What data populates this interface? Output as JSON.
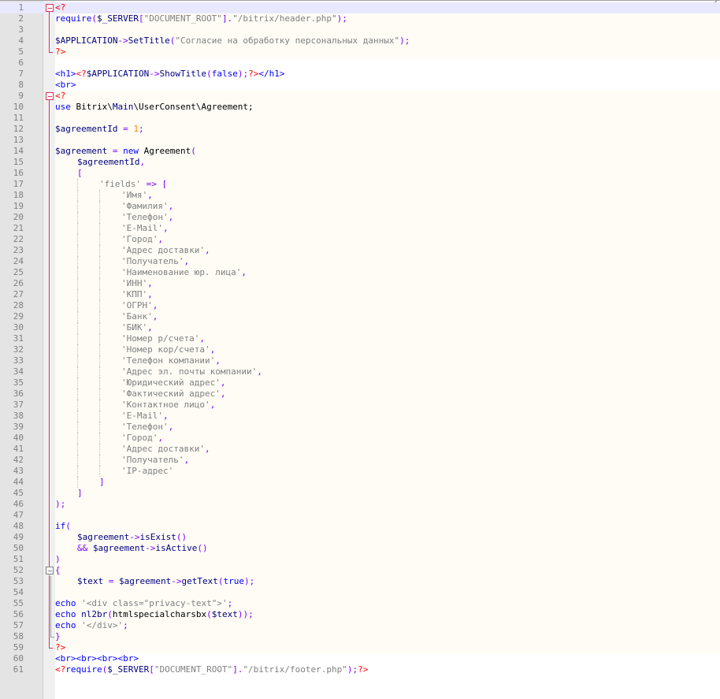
{
  "colors": {
    "php_tag": "#ff0000",
    "keyword": "#0000ff",
    "function": "#000080",
    "variable": "#000080",
    "operator": "#8000ff",
    "string": "#808080",
    "number": "#ff8000",
    "html_tag": "#0000ff",
    "current_line": "#e8e8ff",
    "gutter": "#e4e4e4"
  },
  "editor": {
    "current_line": 1,
    "lines": [
      {
        "n": "1",
        "indent": 0,
        "fold": "open",
        "php": true,
        "tokens": [
          [
            "tag",
            "<?"
          ]
        ]
      },
      {
        "n": "2",
        "indent": 0,
        "fold": "line",
        "php": true,
        "tokens": [
          [
            "kw",
            "require"
          ],
          [
            "op",
            "("
          ],
          [
            "var",
            "$_SERVER"
          ],
          [
            "op",
            "["
          ],
          [
            "str",
            "\"DOCUMENT_ROOT\""
          ],
          [
            "op",
            "]."
          ],
          [
            "str",
            "\"/bitrix/header.php\""
          ],
          [
            "op",
            ");"
          ]
        ]
      },
      {
        "n": "3",
        "indent": 0,
        "fold": "line",
        "php": true,
        "tokens": []
      },
      {
        "n": "4",
        "indent": 0,
        "fold": "line",
        "php": true,
        "tokens": [
          [
            "var",
            "$APPLICATION"
          ],
          [
            "op",
            "->"
          ],
          [
            "fn",
            "SetTitle"
          ],
          [
            "op",
            "("
          ],
          [
            "str",
            "\"Согласие на обработку персональных данных\""
          ],
          [
            "op",
            ");"
          ]
        ]
      },
      {
        "n": "5",
        "indent": 0,
        "fold": "end",
        "php": true,
        "tokens": [
          [
            "tag",
            "?>"
          ]
        ]
      },
      {
        "n": "6",
        "indent": 0,
        "fold": "",
        "php": false,
        "tokens": []
      },
      {
        "n": "7",
        "indent": 0,
        "fold": "",
        "php": false,
        "tokens": [
          [
            "html",
            "<h1>"
          ],
          [
            "tag",
            "<?"
          ],
          [
            "var",
            "$APPLICATION"
          ],
          [
            "op",
            "->"
          ],
          [
            "fn",
            "ShowTitle"
          ],
          [
            "op",
            "("
          ],
          [
            "kw",
            "false"
          ],
          [
            "op",
            ");"
          ],
          [
            "tag",
            "?>"
          ],
          [
            "html",
            "</h1>"
          ]
        ]
      },
      {
        "n": "8",
        "indent": 0,
        "fold": "",
        "php": false,
        "tokens": [
          [
            "html",
            "<br>"
          ]
        ]
      },
      {
        "n": "9",
        "indent": 0,
        "fold": "open",
        "php": true,
        "tokens": [
          [
            "tag",
            "<?"
          ]
        ]
      },
      {
        "n": "10",
        "indent": 0,
        "fold": "line",
        "php": true,
        "tokens": [
          [
            "kw",
            "use"
          ],
          [
            "plain",
            " Bitrix\\"
          ],
          [
            "fn",
            "Main"
          ],
          [
            "plain",
            "\\UserConsent\\Agreement;"
          ]
        ]
      },
      {
        "n": "11",
        "indent": 0,
        "fold": "line",
        "php": true,
        "tokens": []
      },
      {
        "n": "12",
        "indent": 0,
        "fold": "line",
        "php": true,
        "tokens": [
          [
            "var",
            "$agreementId"
          ],
          [
            "op",
            " = "
          ],
          [
            "num",
            "1"
          ],
          [
            "op",
            ";"
          ]
        ]
      },
      {
        "n": "13",
        "indent": 0,
        "fold": "line",
        "php": true,
        "tokens": []
      },
      {
        "n": "14",
        "indent": 0,
        "fold": "line",
        "php": true,
        "tokens": [
          [
            "var",
            "$agreement"
          ],
          [
            "op",
            " = "
          ],
          [
            "kw",
            "new"
          ],
          [
            "plain",
            " Agreement"
          ],
          [
            "op",
            "("
          ]
        ]
      },
      {
        "n": "15",
        "indent": 1,
        "fold": "line",
        "php": true,
        "tokens": [
          [
            "var",
            "$agreementId"
          ],
          [
            "op",
            ","
          ]
        ]
      },
      {
        "n": "16",
        "indent": 1,
        "fold": "line",
        "php": true,
        "tokens": [
          [
            "op",
            "["
          ]
        ]
      },
      {
        "n": "17",
        "indent": 2,
        "fold": "line",
        "php": true,
        "tokens": [
          [
            "str",
            "'fields'"
          ],
          [
            "op",
            " => ["
          ]
        ]
      },
      {
        "n": "18",
        "indent": 3,
        "fold": "line",
        "php": true,
        "tokens": [
          [
            "str",
            "'Имя'"
          ],
          [
            "op",
            ","
          ]
        ]
      },
      {
        "n": "19",
        "indent": 3,
        "fold": "line",
        "php": true,
        "tokens": [
          [
            "str",
            "'Фамилия'"
          ],
          [
            "op",
            ","
          ]
        ]
      },
      {
        "n": "20",
        "indent": 3,
        "fold": "line",
        "php": true,
        "tokens": [
          [
            "str",
            "'Телефон'"
          ],
          [
            "op",
            ","
          ]
        ]
      },
      {
        "n": "21",
        "indent": 3,
        "fold": "line",
        "php": true,
        "tokens": [
          [
            "str",
            "'E-Mail'"
          ],
          [
            "op",
            ","
          ]
        ]
      },
      {
        "n": "22",
        "indent": 3,
        "fold": "line",
        "php": true,
        "tokens": [
          [
            "str",
            "'Город'"
          ],
          [
            "op",
            ","
          ]
        ]
      },
      {
        "n": "23",
        "indent": 3,
        "fold": "line",
        "php": true,
        "tokens": [
          [
            "str",
            "'Адрес доставки'"
          ],
          [
            "op",
            ","
          ]
        ]
      },
      {
        "n": "24",
        "indent": 3,
        "fold": "line",
        "php": true,
        "tokens": [
          [
            "str",
            "'Получатель'"
          ],
          [
            "op",
            ","
          ]
        ]
      },
      {
        "n": "25",
        "indent": 3,
        "fold": "line",
        "php": true,
        "tokens": [
          [
            "str",
            "'Наименование юр. лица'"
          ],
          [
            "op",
            ","
          ]
        ]
      },
      {
        "n": "26",
        "indent": 3,
        "fold": "line",
        "php": true,
        "tokens": [
          [
            "str",
            "'ИНН'"
          ],
          [
            "op",
            ","
          ]
        ]
      },
      {
        "n": "27",
        "indent": 3,
        "fold": "line",
        "php": true,
        "tokens": [
          [
            "str",
            "'КПП'"
          ],
          [
            "op",
            ","
          ]
        ]
      },
      {
        "n": "28",
        "indent": 3,
        "fold": "line",
        "php": true,
        "tokens": [
          [
            "str",
            "'ОГРН'"
          ],
          [
            "op",
            ","
          ]
        ]
      },
      {
        "n": "29",
        "indent": 3,
        "fold": "line",
        "php": true,
        "tokens": [
          [
            "str",
            "'Банк'"
          ],
          [
            "op",
            ","
          ]
        ]
      },
      {
        "n": "30",
        "indent": 3,
        "fold": "line",
        "php": true,
        "tokens": [
          [
            "str",
            "'БИК'"
          ],
          [
            "op",
            ","
          ]
        ]
      },
      {
        "n": "31",
        "indent": 3,
        "fold": "line",
        "php": true,
        "tokens": [
          [
            "str",
            "'Номер р/счета'"
          ],
          [
            "op",
            ","
          ]
        ]
      },
      {
        "n": "32",
        "indent": 3,
        "fold": "line",
        "php": true,
        "tokens": [
          [
            "str",
            "'Номер кор/счета'"
          ],
          [
            "op",
            ","
          ]
        ]
      },
      {
        "n": "33",
        "indent": 3,
        "fold": "line",
        "php": true,
        "tokens": [
          [
            "str",
            "'Телефон компании'"
          ],
          [
            "op",
            ","
          ]
        ]
      },
      {
        "n": "34",
        "indent": 3,
        "fold": "line",
        "php": true,
        "tokens": [
          [
            "str",
            "'Адрес эл. почты компании'"
          ],
          [
            "op",
            ","
          ]
        ]
      },
      {
        "n": "35",
        "indent": 3,
        "fold": "line",
        "php": true,
        "tokens": [
          [
            "str",
            "'Юридический адрес'"
          ],
          [
            "op",
            ","
          ]
        ]
      },
      {
        "n": "36",
        "indent": 3,
        "fold": "line",
        "php": true,
        "tokens": [
          [
            "str",
            "'Фактический адрес'"
          ],
          [
            "op",
            ","
          ]
        ]
      },
      {
        "n": "37",
        "indent": 3,
        "fold": "line",
        "php": true,
        "tokens": [
          [
            "str",
            "'Контактное лицо'"
          ],
          [
            "op",
            ","
          ]
        ]
      },
      {
        "n": "38",
        "indent": 3,
        "fold": "line",
        "php": true,
        "tokens": [
          [
            "str",
            "'E-Mail'"
          ],
          [
            "op",
            ","
          ]
        ]
      },
      {
        "n": "39",
        "indent": 3,
        "fold": "line",
        "php": true,
        "tokens": [
          [
            "str",
            "'Телефон'"
          ],
          [
            "op",
            ","
          ]
        ]
      },
      {
        "n": "40",
        "indent": 3,
        "fold": "line",
        "php": true,
        "tokens": [
          [
            "str",
            "'Город'"
          ],
          [
            "op",
            ","
          ]
        ]
      },
      {
        "n": "41",
        "indent": 3,
        "fold": "line",
        "php": true,
        "tokens": [
          [
            "str",
            "'Адрес доставки'"
          ],
          [
            "op",
            ","
          ]
        ]
      },
      {
        "n": "42",
        "indent": 3,
        "fold": "line",
        "php": true,
        "tokens": [
          [
            "str",
            "'Получатель'"
          ],
          [
            "op",
            ","
          ]
        ]
      },
      {
        "n": "43",
        "indent": 3,
        "fold": "line",
        "php": true,
        "tokens": [
          [
            "str",
            "'IP-адрес'"
          ]
        ]
      },
      {
        "n": "44",
        "indent": 2,
        "fold": "line",
        "php": true,
        "tokens": [
          [
            "op",
            "]"
          ]
        ]
      },
      {
        "n": "45",
        "indent": 1,
        "fold": "line",
        "php": true,
        "tokens": [
          [
            "op",
            "]"
          ]
        ]
      },
      {
        "n": "46",
        "indent": 0,
        "fold": "line",
        "php": true,
        "tokens": [
          [
            "op",
            ");"
          ]
        ]
      },
      {
        "n": "47",
        "indent": 0,
        "fold": "line",
        "php": true,
        "tokens": []
      },
      {
        "n": "48",
        "indent": 0,
        "fold": "line",
        "php": true,
        "tokens": [
          [
            "kw",
            "if"
          ],
          [
            "op",
            "("
          ]
        ]
      },
      {
        "n": "49",
        "indent": 1,
        "fold": "line",
        "php": true,
        "tokens": [
          [
            "var",
            "$agreement"
          ],
          [
            "op",
            "->"
          ],
          [
            "fn",
            "isExist"
          ],
          [
            "op",
            "()"
          ]
        ]
      },
      {
        "n": "50",
        "indent": 1,
        "fold": "line",
        "php": true,
        "tokens": [
          [
            "op",
            "&& "
          ],
          [
            "var",
            "$agreement"
          ],
          [
            "op",
            "->"
          ],
          [
            "fn",
            "isActive"
          ],
          [
            "op",
            "()"
          ]
        ]
      },
      {
        "n": "51",
        "indent": 0,
        "fold": "line",
        "php": true,
        "tokens": [
          [
            "op",
            ")"
          ]
        ]
      },
      {
        "n": "52",
        "indent": 0,
        "fold": "open-gray",
        "php": true,
        "tokens": [
          [
            "op",
            "{"
          ]
        ]
      },
      {
        "n": "53",
        "indent": 1,
        "fold": "line-gray",
        "php": true,
        "tokens": [
          [
            "var",
            "$text"
          ],
          [
            "op",
            " = "
          ],
          [
            "var",
            "$agreement"
          ],
          [
            "op",
            "->"
          ],
          [
            "fn",
            "getText"
          ],
          [
            "op",
            "("
          ],
          [
            "kw",
            "true"
          ],
          [
            "op",
            ");"
          ]
        ]
      },
      {
        "n": "54",
        "indent": 0,
        "fold": "line-gray",
        "php": true,
        "tokens": []
      },
      {
        "n": "55",
        "indent": 0,
        "fold": "line-gray",
        "php": true,
        "tokens": [
          [
            "kw",
            "echo"
          ],
          [
            "plain",
            " "
          ],
          [
            "str",
            "'<div class=\"privacy-text\">'"
          ],
          [
            "op",
            ";"
          ]
        ]
      },
      {
        "n": "56",
        "indent": 0,
        "fold": "line-gray",
        "php": true,
        "tokens": [
          [
            "kw",
            "echo"
          ],
          [
            "plain",
            " "
          ],
          [
            "fn",
            "nl2br"
          ],
          [
            "op",
            "("
          ],
          [
            "plain",
            "htmlspecialcharsbx"
          ],
          [
            "op",
            "("
          ],
          [
            "var",
            "$text"
          ],
          [
            "op",
            "));"
          ]
        ]
      },
      {
        "n": "57",
        "indent": 0,
        "fold": "line-gray",
        "php": true,
        "tokens": [
          [
            "kw",
            "echo"
          ],
          [
            "plain",
            " "
          ],
          [
            "str",
            "'</div>'"
          ],
          [
            "op",
            ";"
          ]
        ]
      },
      {
        "n": "58",
        "indent": 0,
        "fold": "end-gray",
        "php": true,
        "tokens": [
          [
            "op",
            "}"
          ]
        ]
      },
      {
        "n": "59",
        "indent": 0,
        "fold": "end",
        "php": true,
        "tokens": [
          [
            "tag",
            "?>"
          ]
        ]
      },
      {
        "n": "60",
        "indent": 0,
        "fold": "",
        "php": false,
        "tokens": [
          [
            "html",
            "<br><br><br><br>"
          ]
        ]
      },
      {
        "n": "61",
        "indent": 0,
        "fold": "",
        "php": false,
        "tokens": [
          [
            "tag",
            "<?"
          ],
          [
            "kw",
            "require"
          ],
          [
            "op",
            "("
          ],
          [
            "var",
            "$_SERVER"
          ],
          [
            "op",
            "["
          ],
          [
            "str",
            "\"DOCUMENT_ROOT\""
          ],
          [
            "op",
            "]."
          ],
          [
            "str",
            "\"/bitrix/footer.php\""
          ],
          [
            "op",
            ");"
          ],
          [
            "tag",
            "?>"
          ]
        ]
      }
    ]
  }
}
